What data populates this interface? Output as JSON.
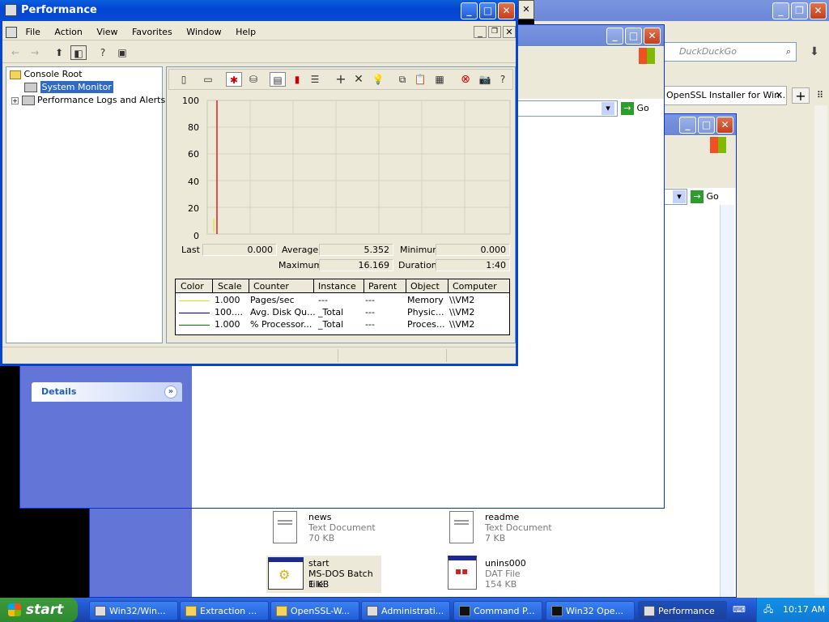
{
  "perf": {
    "title": "Performance",
    "menu": [
      "File",
      "Action",
      "View",
      "Favorites",
      "Window",
      "Help"
    ],
    "tree": {
      "root": "Console Root",
      "items": [
        "System Monitor",
        "Performance Logs and Alerts"
      ]
    },
    "stats": {
      "last_label": "Last",
      "last": "0.000",
      "average_label": "Average",
      "average": "5.352",
      "minimum_label": "Minimum",
      "minimum": "0.000",
      "maximum_label": "Maximum",
      "maximum": "16.169",
      "duration_label": "Duration",
      "duration": "1:40"
    },
    "yticks": [
      "100",
      "80",
      "60",
      "40",
      "20",
      "0"
    ],
    "columns": [
      "Color",
      "Scale",
      "Counter",
      "Instance",
      "Parent",
      "Object",
      "Computer"
    ],
    "counters": [
      {
        "color": "#e8e000",
        "scale": "1.000",
        "counter": "Pages/sec",
        "instance": "---",
        "parent": "---",
        "object": "Memory",
        "computer": "\\\\VM2"
      },
      {
        "color": "#000080",
        "scale": "100....",
        "counter": "Avg. Disk Qu...",
        "instance": "_Total",
        "parent": "---",
        "object": "Physic...",
        "computer": "\\\\VM2"
      },
      {
        "color": "#008000",
        "scale": "1.000",
        "counter": "% Processor...",
        "instance": "_Total",
        "parent": "---",
        "object": "Proces...",
        "computer": "\\\\VM2"
      }
    ]
  },
  "browser": {
    "search_placeholder": "DuckDuckGo",
    "tab_label": "OpenSSL Installer for Win...",
    "go_label": "Go"
  },
  "explorer": {
    "details_label": "Details",
    "go_label": "Go",
    "files": [
      {
        "name": "news",
        "type": "Text Document",
        "size": "70 KB"
      },
      {
        "name": "readme",
        "type": "Text Document",
        "size": "7 KB"
      },
      {
        "name": "start",
        "type": "MS-DOS Batch File",
        "size": "1 KB"
      },
      {
        "name": "unins000",
        "type": "DAT File",
        "size": "154 KB"
      }
    ]
  },
  "taskbar": {
    "start": "start",
    "items": [
      "Win32/Win...",
      "Extraction ...",
      "OpenSSL-W...",
      "Administrati...",
      "Command P...",
      "Win32 Ope...",
      "Performance"
    ],
    "clock": "10:17 AM"
  }
}
